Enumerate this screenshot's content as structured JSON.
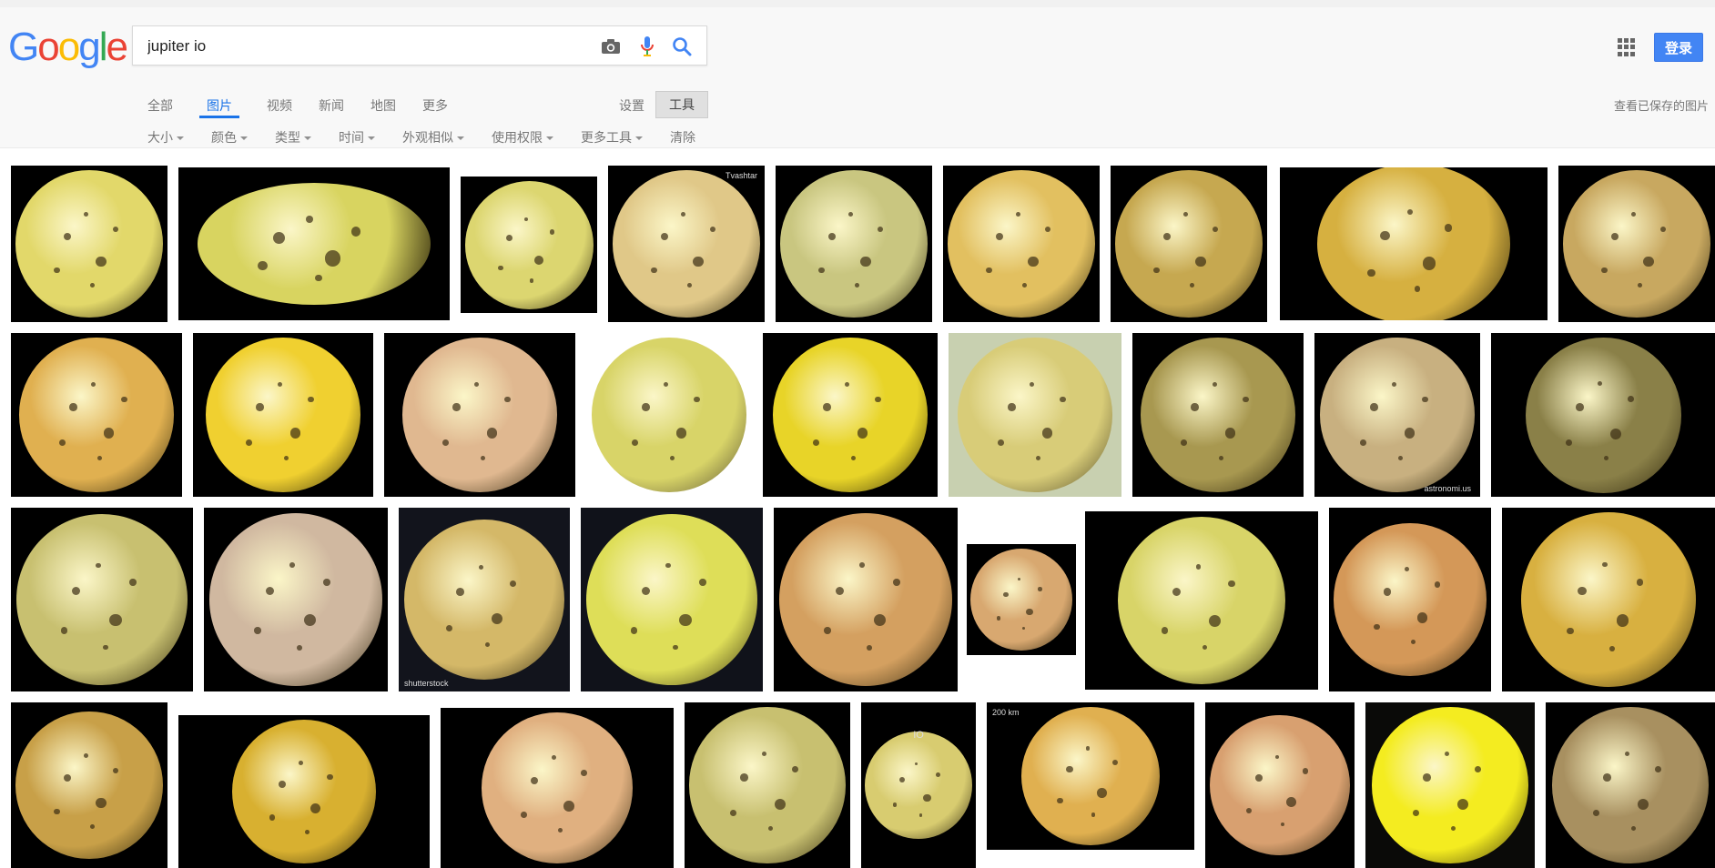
{
  "search": {
    "query": "jupiter io"
  },
  "header": {
    "login_label": "登录",
    "saved_label": "查看已保存的图片"
  },
  "nav": {
    "tabs": [
      {
        "label": "全部",
        "active": false
      },
      {
        "label": "图片",
        "active": true
      },
      {
        "label": "视频",
        "active": false
      },
      {
        "label": "新闻",
        "active": false
      },
      {
        "label": "地图",
        "active": false
      },
      {
        "label": "更多",
        "active": false
      }
    ],
    "settings_label": "设置",
    "tools_label": "工具"
  },
  "filters": [
    {
      "label": "大小",
      "dropdown": true
    },
    {
      "label": "颜色",
      "dropdown": true
    },
    {
      "label": "类型",
      "dropdown": true
    },
    {
      "label": "时间",
      "dropdown": true
    },
    {
      "label": "外观相似",
      "dropdown": true
    },
    {
      "label": "使用权限",
      "dropdown": true
    },
    {
      "label": "更多工具",
      "dropdown": true
    },
    {
      "label": "清除",
      "dropdown": false
    }
  ],
  "image_captions": [
    "Tvashtar",
    "astronomi.us",
    "shutterstock",
    "IO",
    "200 km"
  ],
  "colors": {
    "accent": "#1a73e8",
    "login_bg": "#4285f4",
    "header_bg": "#f8f8f8"
  }
}
